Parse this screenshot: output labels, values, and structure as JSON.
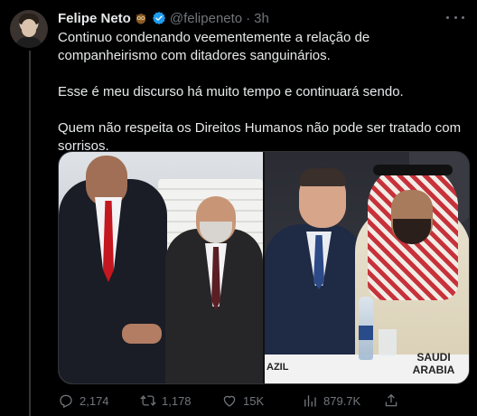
{
  "author": {
    "name": "Felipe Neto",
    "handle": "@felipeneto",
    "separator": "·",
    "time": "3h",
    "badge_icon": "owl-emoji-icon",
    "verified_icon": "verified-badge-icon"
  },
  "tweet": {
    "paragraphs": [
      "Continuo condenando veementemente a relação de companheirismo com ditadores sanguinários.",
      "Esse é meu discurso há muito tempo e continuará sendo.",
      "Quem não respeita os Direitos Humanos não pode ser tratado com sorrisos."
    ]
  },
  "media": {
    "left_photo": "handshake-photo",
    "right_photo": "meeting-photo",
    "nameplate_left": "AZIL",
    "nameplate_right": "SAUDI\nARABIA"
  },
  "actions": {
    "replies": "2,174",
    "retweets": "1,178",
    "likes": "15K",
    "views": "879.7K"
  },
  "colors": {
    "background": "#000000",
    "text_primary": "#e7e9ea",
    "text_secondary": "#71767b",
    "verified": "#1d9bf0",
    "border": "#2f3336"
  }
}
